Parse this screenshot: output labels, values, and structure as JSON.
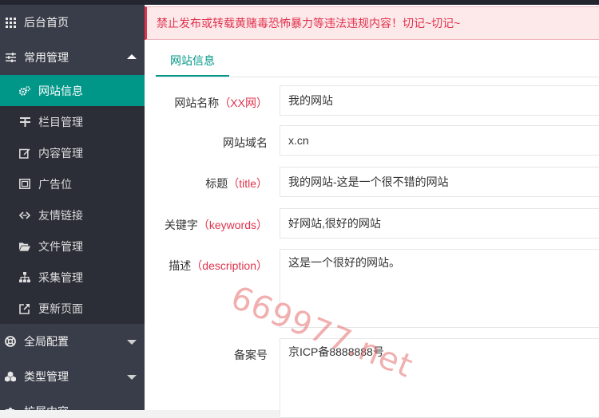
{
  "sidebar": {
    "items": [
      {
        "label": "后台首页",
        "icon": "grid-icon"
      },
      {
        "label": "常用管理",
        "icon": "sliders-icon"
      },
      {
        "label": "网站信息",
        "icon": "cogs-icon"
      },
      {
        "label": "栏目管理",
        "icon": "columns-icon"
      },
      {
        "label": "内容管理",
        "icon": "edit-icon"
      },
      {
        "label": "广告位",
        "icon": "image-icon"
      },
      {
        "label": "友情链接",
        "icon": "link-icon"
      },
      {
        "label": "文件管理",
        "icon": "folder-open-icon"
      },
      {
        "label": "采集管理",
        "icon": "sitemap-icon"
      },
      {
        "label": "更新页面",
        "icon": "external-link-icon"
      },
      {
        "label": "全局配置",
        "icon": "lifebuoy-icon"
      },
      {
        "label": "类型管理",
        "icon": "cubes-icon"
      },
      {
        "label": "扩展内容",
        "icon": "puzzle-icon"
      }
    ]
  },
  "alert": {
    "text": "禁止发布或转载黄赌毒恐怖暴力等违法违规内容！切记~切记~"
  },
  "tab": {
    "label": "网站信息"
  },
  "form": {
    "site_name": {
      "label": "网站名称",
      "hint": "（XX网）",
      "value": "我的网站"
    },
    "domain": {
      "label": "网站域名",
      "value": "x.cn"
    },
    "title": {
      "label": "标题",
      "hint": "（title）",
      "value": "我的网站-这是一个很不错的网站"
    },
    "keywords": {
      "label": "关键字",
      "hint": "（keywords）",
      "value": "好网站,很好的网站"
    },
    "description": {
      "label": "描述",
      "hint": "（description）",
      "value": "这是一个很好的网站。"
    },
    "icp": {
      "label": "备案号",
      "value": "京ICP备8888888号"
    }
  },
  "watermark": {
    "text": "669977.net"
  },
  "colors": {
    "accent": "#009688",
    "sidebar": "#393d49",
    "alert": "#e0334d"
  }
}
